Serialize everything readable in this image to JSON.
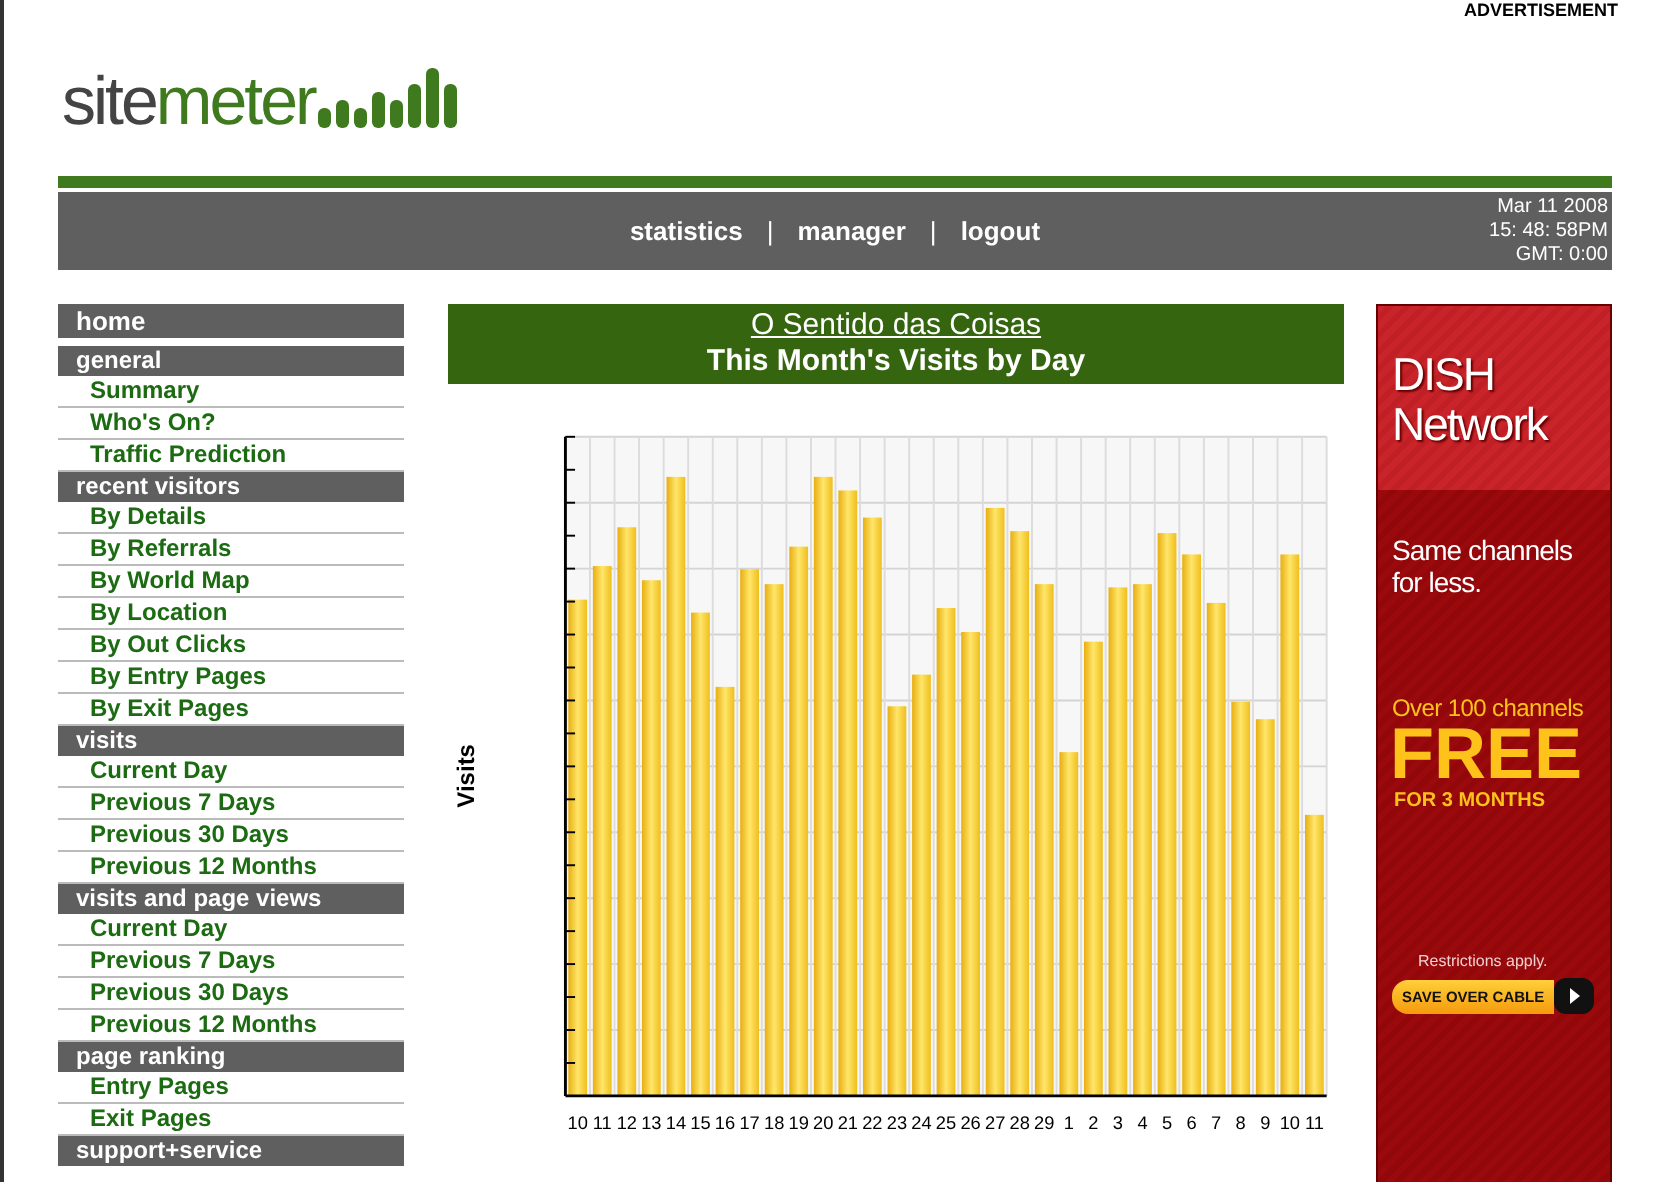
{
  "header": {
    "advertisement_label": "ADVERTISEMENT",
    "logo": [
      "site",
      "meter"
    ]
  },
  "nav": {
    "links": [
      "statistics",
      "manager",
      "logout"
    ],
    "separators": [
      "|",
      "|"
    ],
    "date": "Mar 11 2008",
    "time": "15: 48: 58PM",
    "timezone": "GMT: 0:00"
  },
  "sidebar": [
    {
      "kind": "home",
      "label": "home"
    },
    {
      "kind": "section",
      "label": "general",
      "items": [
        "Summary",
        "Who's On?",
        "Traffic Prediction"
      ]
    },
    {
      "kind": "section",
      "label": "recent visitors",
      "items": [
        "By Details",
        "By Referrals",
        "By World Map",
        "By Location",
        "By Out Clicks",
        "By Entry Pages",
        "By Exit Pages"
      ]
    },
    {
      "kind": "section",
      "label": "visits",
      "items": [
        "Current Day",
        "Previous 7 Days",
        "Previous 30 Days",
        "Previous 12 Months"
      ]
    },
    {
      "kind": "section",
      "label": "visits and page views",
      "items": [
        "Current Day",
        "Previous 7 Days",
        "Previous 30 Days",
        "Previous 12 Months"
      ]
    },
    {
      "kind": "section",
      "label": "page ranking",
      "items": [
        "Entry Pages",
        "Exit Pages"
      ]
    },
    {
      "kind": "section",
      "label": "support+service"
    }
  ],
  "chart": {
    "site_link": "O Sentido das Coisas",
    "title": "This Month's Visits by Day",
    "ylabel": "Visits",
    "x_labels": [
      "10",
      "11",
      "12",
      "13",
      "14",
      "15",
      "16",
      "17",
      "18",
      "19",
      "20",
      "21",
      "22",
      "23",
      "24",
      "25",
      "26",
      "27",
      "28",
      "29",
      "1",
      "2",
      "3",
      "4",
      "5",
      "6",
      "7",
      "8",
      "9",
      "10",
      "11"
    ]
  },
  "ad": {
    "headline": "DISH Network",
    "tagline": "Same channels for less.",
    "offer_intro": "Over 100 channels",
    "offer": "FREE",
    "offer_term": "FOR 3 MONTHS",
    "fine_print": "Restrictions apply.",
    "button": "SAVE OVER CABLE"
  }
}
